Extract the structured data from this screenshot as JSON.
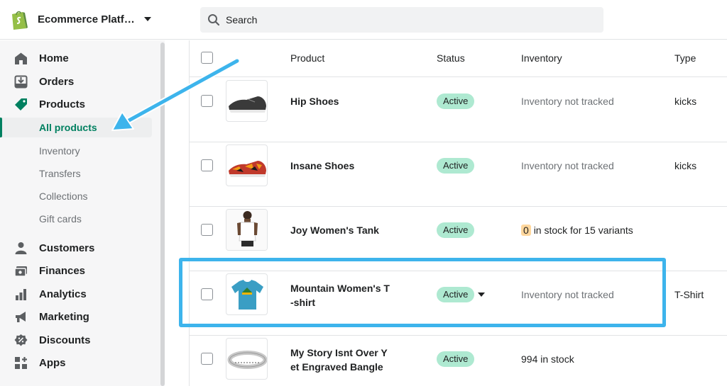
{
  "topbar": {
    "store_name": "Ecommerce Platfor...",
    "search_placeholder": "Search"
  },
  "sidebar": {
    "items": [
      {
        "label": "Home",
        "icon": "home-icon"
      },
      {
        "label": "Orders",
        "icon": "orders-icon"
      },
      {
        "label": "Products",
        "icon": "tag-icon"
      },
      {
        "label": "Customers",
        "icon": "person-icon"
      },
      {
        "label": "Finances",
        "icon": "finances-icon"
      },
      {
        "label": "Analytics",
        "icon": "bar-chart-icon"
      },
      {
        "label": "Marketing",
        "icon": "megaphone-icon"
      },
      {
        "label": "Discounts",
        "icon": "discount-icon"
      },
      {
        "label": "Apps",
        "icon": "apps-icon"
      }
    ],
    "product_subitems": [
      {
        "label": "All products",
        "active": true
      },
      {
        "label": "Inventory",
        "active": false
      },
      {
        "label": "Transfers",
        "active": false
      },
      {
        "label": "Collections",
        "active": false
      },
      {
        "label": "Gift cards",
        "active": false
      }
    ]
  },
  "table": {
    "headers": {
      "product": "Product",
      "status": "Status",
      "inventory": "Inventory",
      "type": "Type"
    },
    "rows": [
      {
        "name": "Hip Shoes",
        "status": "Active",
        "inventory": "Inventory not tracked",
        "type": "kicks",
        "thumb": "dark sneaker"
      },
      {
        "name": "Insane Shoes",
        "status": "Active",
        "inventory": "Inventory not tracked",
        "type": "kicks",
        "thumb": "floral sneaker"
      },
      {
        "name": "Joy Women's Tank",
        "status": "Active",
        "inventory_count": "0",
        "inventory": "in stock for 15 variants",
        "type": "",
        "thumb": "white tank top"
      },
      {
        "name": "Mountain Women's T\n-shirt",
        "name_line1": "Mountain Women's T",
        "name_line2": "-shirt",
        "status": "Active",
        "inventory": "Inventory not tracked",
        "type": "T-Shirt",
        "thumb": "teal t-shirt"
      },
      {
        "name_line1": "My Story Isnt Over Y",
        "name_line2": "et Engraved Bangle",
        "status": "Active",
        "inventory": "994 in stock",
        "type": "",
        "thumb": "engraved bangle"
      }
    ]
  },
  "colors": {
    "accent_green": "#008060",
    "badge_green": "#aee9d1",
    "annotation_blue": "#3db4ec"
  }
}
